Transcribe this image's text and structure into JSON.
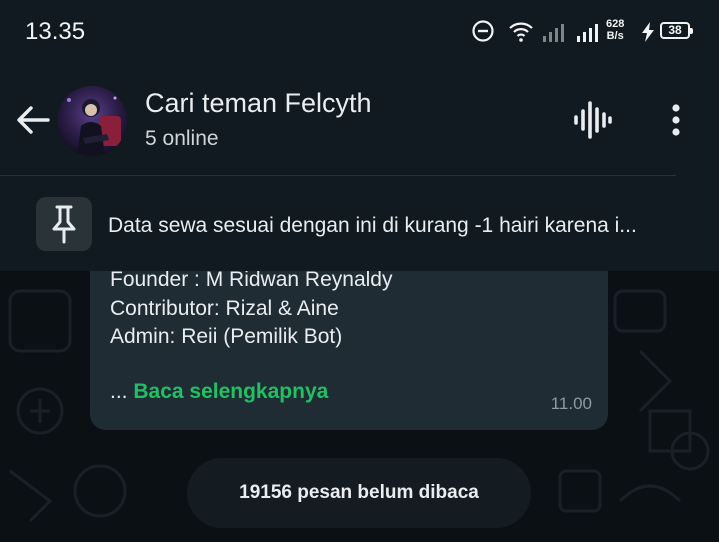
{
  "status_bar": {
    "time": "13.35",
    "net_speed_value": "628",
    "net_speed_unit": "B/s",
    "battery": "38"
  },
  "header": {
    "title": "Cari teman Felcyth",
    "subtitle": "5 online"
  },
  "pinned": {
    "text": "Data sewa sesuai dengan ini di kurang -1 hairi karena i..."
  },
  "message": {
    "lines": [
      "Founder : M Ridwan Reynaldy",
      "Contributor: Rizal & Aine",
      "Admin: Reii (Pemilik Bot)"
    ],
    "ellipsis": "...",
    "read_more": "Baca selengkapnya",
    "time": "11.00"
  },
  "unread_banner": "19156 pesan belum dibaca",
  "colors": {
    "background": "#0b1014",
    "header": "#111a20",
    "bubble": "#1f2c33",
    "accent_green": "#21c063"
  },
  "icons": [
    "minus-circle-icon",
    "wifi-icon",
    "signal-icon",
    "charging-bolt-icon",
    "back-arrow-icon",
    "voice-chat-icon",
    "more-vert-icon",
    "pin-icon"
  ]
}
